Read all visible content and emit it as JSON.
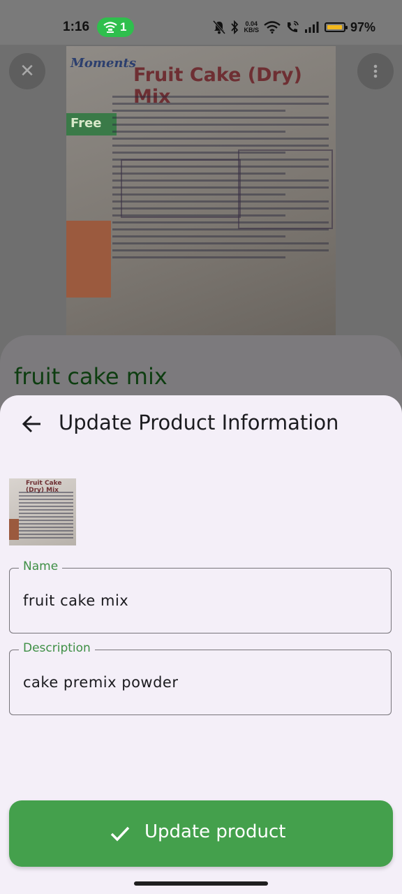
{
  "status_bar": {
    "time": "1:16",
    "hotspot_count": "1",
    "speed_value": "0.04",
    "speed_unit": "KB/S",
    "battery_percent_label": "97%",
    "battery_level": 0.97
  },
  "product_photo": {
    "brand_text": "Moments",
    "title_text": "Fruit Cake (Dry) Mix",
    "badge_text": "Free"
  },
  "background": {
    "product_name": "fruit cake mix"
  },
  "sheet": {
    "title": "Update Product Information",
    "name_field": {
      "label": "Name",
      "value": "fruit cake mix"
    },
    "description_field": {
      "label": "Description",
      "value": "cake premix powder"
    },
    "submit_label": "Update product"
  },
  "colors": {
    "accent": "#44a04c",
    "label_green": "#3e8f45",
    "sheet_bg": "#f4eff8",
    "battery": "#f2b81d"
  }
}
